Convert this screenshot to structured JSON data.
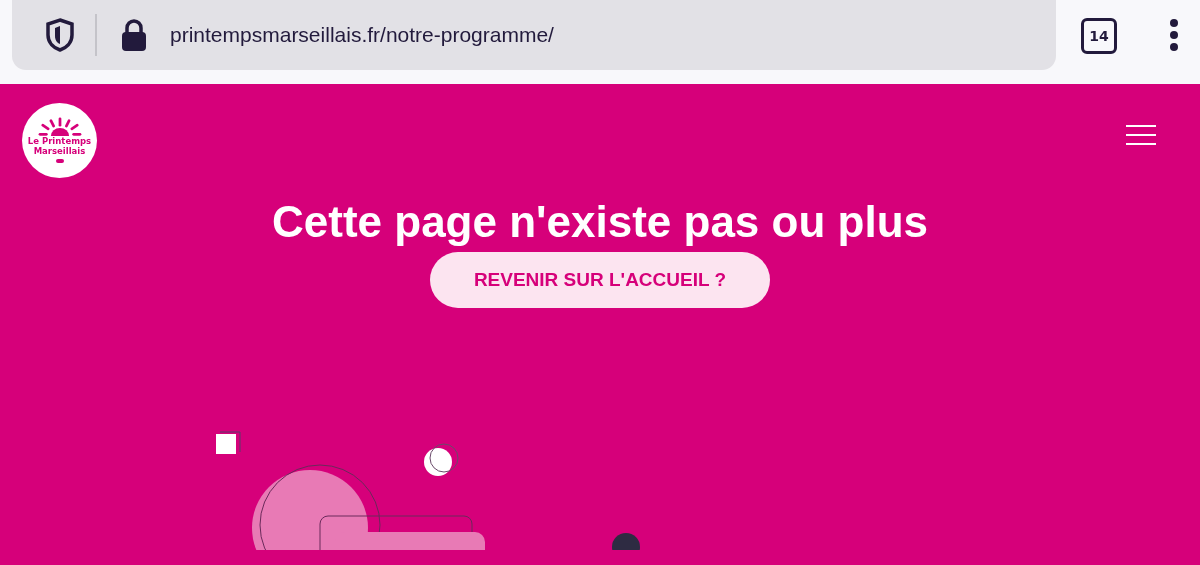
{
  "browser": {
    "url": "printempsmarseillais.fr/notre-programme/",
    "tab_count": "14"
  },
  "site": {
    "logo_lines": [
      "Le Printemps",
      "Marseillais"
    ],
    "heading": "Cette page n'existe pas ou plus",
    "button": "REVENIR SUR L'ACCUEIL ?"
  }
}
